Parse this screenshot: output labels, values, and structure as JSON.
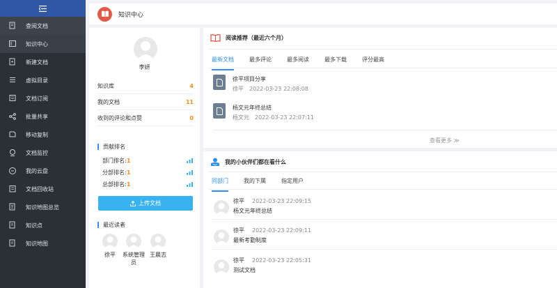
{
  "sidebar": {
    "items": [
      {
        "label": "查阅文档",
        "icon": "doc-search-icon"
      },
      {
        "label": "知识中心",
        "icon": "knowledge-icon"
      },
      {
        "label": "新建文档",
        "icon": "new-doc-icon"
      },
      {
        "label": "虚拟目录",
        "icon": "virtual-dir-icon"
      },
      {
        "label": "文档订阅",
        "icon": "subscribe-icon"
      },
      {
        "label": "批量共享",
        "icon": "share-icon"
      },
      {
        "label": "移动复制",
        "icon": "move-copy-icon"
      },
      {
        "label": "文档监控",
        "icon": "monitor-icon"
      },
      {
        "label": "我的云盘",
        "icon": "cloud-icon"
      },
      {
        "label": "文档回收站",
        "icon": "recycle-icon"
      },
      {
        "label": "知识地图总览",
        "icon": "map-overview-icon"
      },
      {
        "label": "知识点",
        "icon": "knowledge-point-icon"
      },
      {
        "label": "知识地图",
        "icon": "knowledge-map-icon"
      }
    ]
  },
  "header": {
    "title": "知识中心"
  },
  "profile": {
    "name": "李妍",
    "stats": [
      {
        "label": "知识库",
        "value": "4"
      },
      {
        "label": "我的文档",
        "value": "11"
      },
      {
        "label": "收到的评论和点赞",
        "value": "0"
      }
    ],
    "rank_title": "贡献排名",
    "ranks": [
      {
        "label": "部门排名:",
        "value": "1"
      },
      {
        "label": "分部排名:",
        "value": "1"
      },
      {
        "label": "总部排名:",
        "value": "1"
      }
    ],
    "upload_label": "上传文档",
    "readers_title": "最近读者",
    "readers": [
      {
        "name": "徐平"
      },
      {
        "name": "系统管理员"
      },
      {
        "name": "王晨志"
      }
    ]
  },
  "recommend": {
    "title": "阅读推荐（最近六个月）",
    "tabs": [
      "最新文档",
      "最多评论",
      "最多阅读",
      "最多下载",
      "评分最高"
    ],
    "docs": [
      {
        "title": "徐平项目分享",
        "author": "徐平",
        "time": "2022-03-23 22:08:08"
      },
      {
        "title": "杨文元年终总结",
        "author": "杨文元",
        "time": "2022-03-23 22:07:11"
      }
    ],
    "more": "查看更多 ≫"
  },
  "activity": {
    "title": "我的小伙伴们都在看什么",
    "tabs": [
      "同部门",
      "我的下属",
      "指定用户"
    ],
    "items": [
      {
        "who": "徐平",
        "time": "2022-03-23 22:09:15",
        "doc": "杨文元年终总结"
      },
      {
        "who": "徐平",
        "time": "2022-03-23 22:09:11",
        "doc": "最新考勤制度"
      },
      {
        "who": "徐平",
        "time": "2022-03-23 22:05:31",
        "doc": "测试文档"
      }
    ]
  },
  "colors": {
    "sidebar_bg": "#2b2f36",
    "sidebar_top": "#2f57a3",
    "accent": "#2f8ff0",
    "orange": "#f38c1d",
    "upload": "#38b3ef",
    "logo": "#e25a48"
  }
}
